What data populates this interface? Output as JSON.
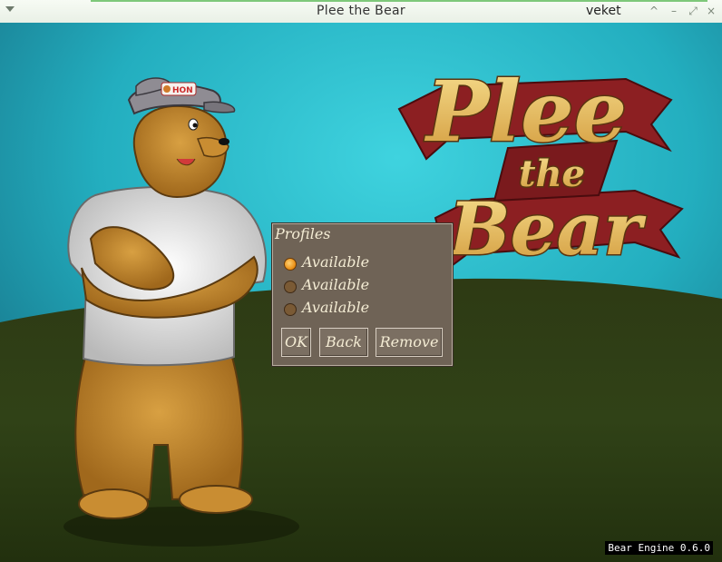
{
  "window": {
    "title": "Plee the Bear",
    "right_label": "veket",
    "controls": [
      "^",
      "–",
      "⤢",
      "×"
    ]
  },
  "game": {
    "logo_text": [
      "Plee",
      "the",
      "Bear"
    ],
    "cap_text": "HON"
  },
  "dialog": {
    "title": "Profiles",
    "profiles": [
      {
        "label": "Available",
        "selected": true
      },
      {
        "label": "Available",
        "selected": false
      },
      {
        "label": "Available",
        "selected": false
      }
    ],
    "buttons": {
      "ok": "OK",
      "back": "Back",
      "remove": "Remove"
    }
  },
  "footer": {
    "engine_version": "Bear Engine 0.6.0"
  },
  "colors": {
    "sky": "#2fc0cf",
    "hill": "#2a3612",
    "dialog_bg": "#6f6356",
    "ribbon": "#8c1f22"
  }
}
